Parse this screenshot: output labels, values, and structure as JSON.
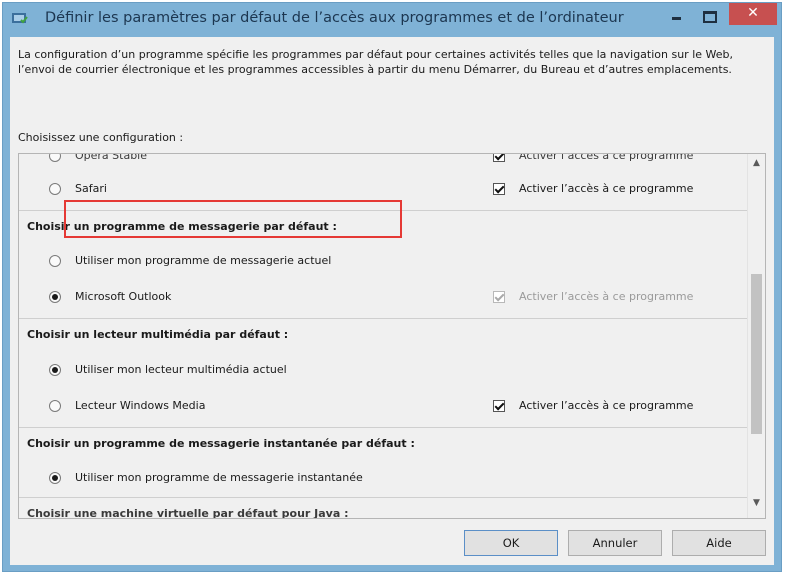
{
  "window": {
    "title": "Définir les paramètres par défaut de l’accès aux programmes et de l’ordinateur",
    "close_glyph": "✕"
  },
  "description": "La configuration d’un programme spécifie les programmes par défaut pour certaines activités telles que la navigation sur le Web, l’envoi de courrier électronique et les programmes accessibles à partir du menu Démarrer, du Bureau et d’autres emplacements.",
  "choose_label": "Choisissez une configuration :",
  "enable_label": "Activer l’accès à ce programme",
  "rows": {
    "opera": "Opera Stable",
    "safari": "Safari"
  },
  "sections": {
    "mail": {
      "heading": "Choisir un programme de messagerie par défaut :",
      "current": "Utiliser mon programme de messagerie actuel",
      "outlook": "Microsoft Outlook"
    },
    "media": {
      "heading": "Choisir un lecteur multimédia par défaut :",
      "current": "Utiliser mon lecteur multimédia actuel",
      "wmp": "Lecteur Windows Media"
    },
    "im": {
      "heading": "Choisir un programme de messagerie instantanée par défaut :",
      "current": "Utiliser mon programme de messagerie instantanée"
    },
    "java": {
      "heading": "Choisir une machine virtuelle par défaut pour Java :"
    }
  },
  "buttons": {
    "ok": "OK",
    "cancel": "Annuler",
    "help": "Aide"
  },
  "scroll": {
    "up": "▲",
    "down": "▼"
  }
}
